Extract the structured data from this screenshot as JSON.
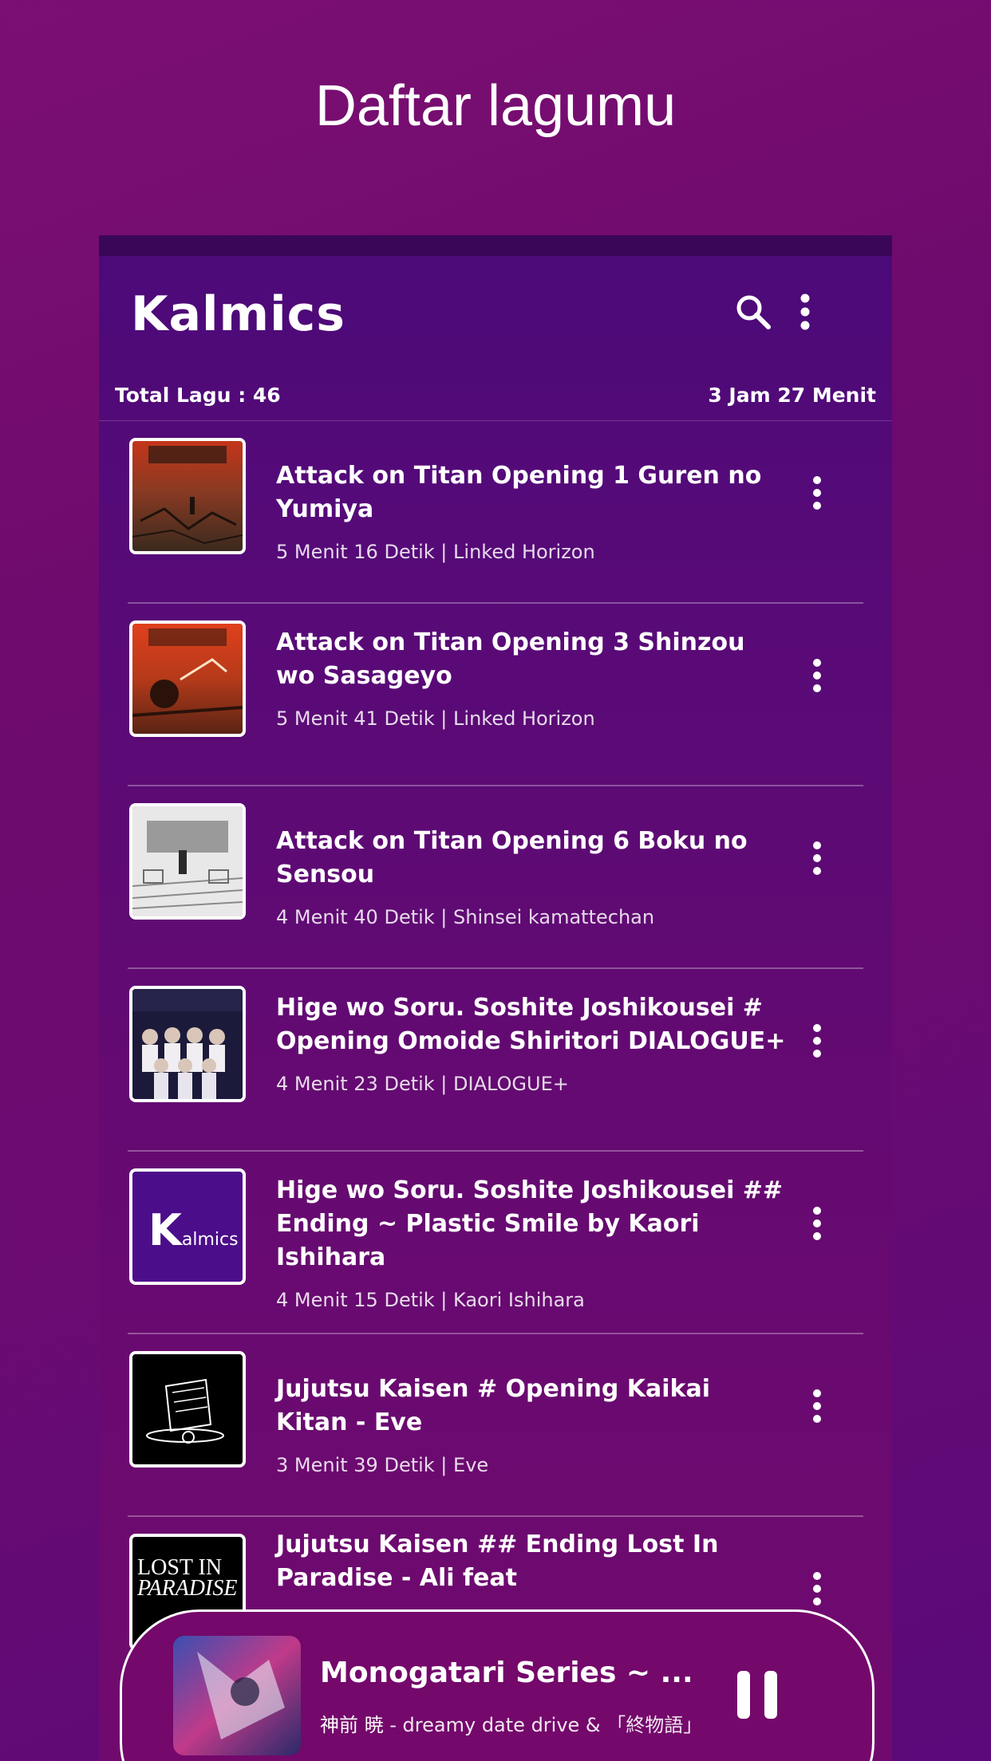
{
  "promo": {
    "title": "Daftar lagumu"
  },
  "app": {
    "title": "Kalmics"
  },
  "toolbar": {
    "search_icon": "search-icon",
    "menu_icon": "more-vertical-icon"
  },
  "summary": {
    "total": "Total Lagu : 46",
    "duration": "3 Jam 27 Menit"
  },
  "songs": [
    {
      "title": "Attack on Titan Opening 1 Guren no Yumiya",
      "meta": "5 Menit 16 Detik | Linked Horizon"
    },
    {
      "title": "Attack on Titan Opening 3 Shinzou wo Sasageyo",
      "meta": "5 Menit 41 Detik | Linked Horizon"
    },
    {
      "title": "Attack on Titan Opening 6 Boku no Sensou",
      "meta": "4 Menit 40 Detik | Shinsei kamattechan"
    },
    {
      "title": "Hige wo Soru. Soshite Joshikousei # Opening Omoide Shiritori DIALOGUE+",
      "meta": "4 Menit 23 Detik | DIALOGUE+"
    },
    {
      "title": "Hige wo Soru. Soshite Joshikousei ## Ending ~ Plastic Smile by Kaori Ishihara",
      "meta": "4 Menit 15 Detik | Kaori Ishihara"
    },
    {
      "title": "Jujutsu Kaisen # Opening Kaikai Kitan - Eve",
      "meta": "3 Menit 39 Detik | Eve"
    },
    {
      "title": "Jujutsu Kaisen ## Ending Lost In Paradise - Ali feat",
      "meta": ""
    }
  ],
  "placeholder_art": {
    "big": "K",
    "small": "almics"
  },
  "lost_art": {
    "line1": "LOST IN",
    "line2": "PARADISE"
  },
  "now_playing": {
    "title": "Monogatari Series ~ ...",
    "artist": "神前 暁",
    "subtitle_rest": " - dreamy date drive & 「終物語」"
  },
  "colors": {
    "accent": "#560a78",
    "background": "#74086b"
  }
}
